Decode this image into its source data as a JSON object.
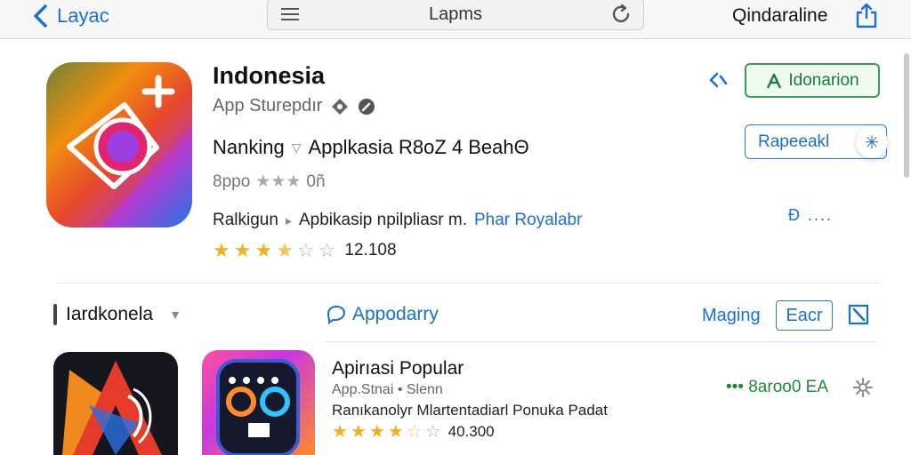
{
  "topbar": {
    "back_label": "Layac",
    "url_title": "Lapms",
    "right_title": "Qindaraline",
    "icons": {
      "back": "chevron-left-icon",
      "menu": "hamburger-menu-icon",
      "reload": "reload-icon",
      "share": "share-icon"
    }
  },
  "app": {
    "name": "Indonesia",
    "subtitle": "App Sturepdır",
    "rank_label": "Nanking",
    "rank_value": "Applkasia R8oZ  4 BeahΘ",
    "small_rating_prefix": "8ppo",
    "small_rating_suffix": "0ñ",
    "category_prefix": "Ralkigun",
    "category_text": "Apbikasip npilpliasr m.",
    "category_link": "Phar Royalabr",
    "rating_stars": 3.5,
    "rating_count": "12.108",
    "install_button": "Idonarion",
    "secondary_button": "Rapeeakl",
    "more_link": "Ð ....",
    "accent_green": "#3a9a56",
    "accent_blue": "#1a6fd6",
    "star_color": "#f2b01e"
  },
  "section": {
    "title": "Iardkonela",
    "tab_label": "Appodarry",
    "magic_link": "Maging",
    "each_button": "Eacr"
  },
  "list": [
    {
      "title": "Apirıasi Popular",
      "subtitle": "App.Stnai • Slenn",
      "description": "Ranıkanolyr Mlartentadiarl Ponuka Padat",
      "rating_stars": 4.5,
      "rating_count": "40.300",
      "action_label": "••• 8aroo0 EA"
    }
  ]
}
